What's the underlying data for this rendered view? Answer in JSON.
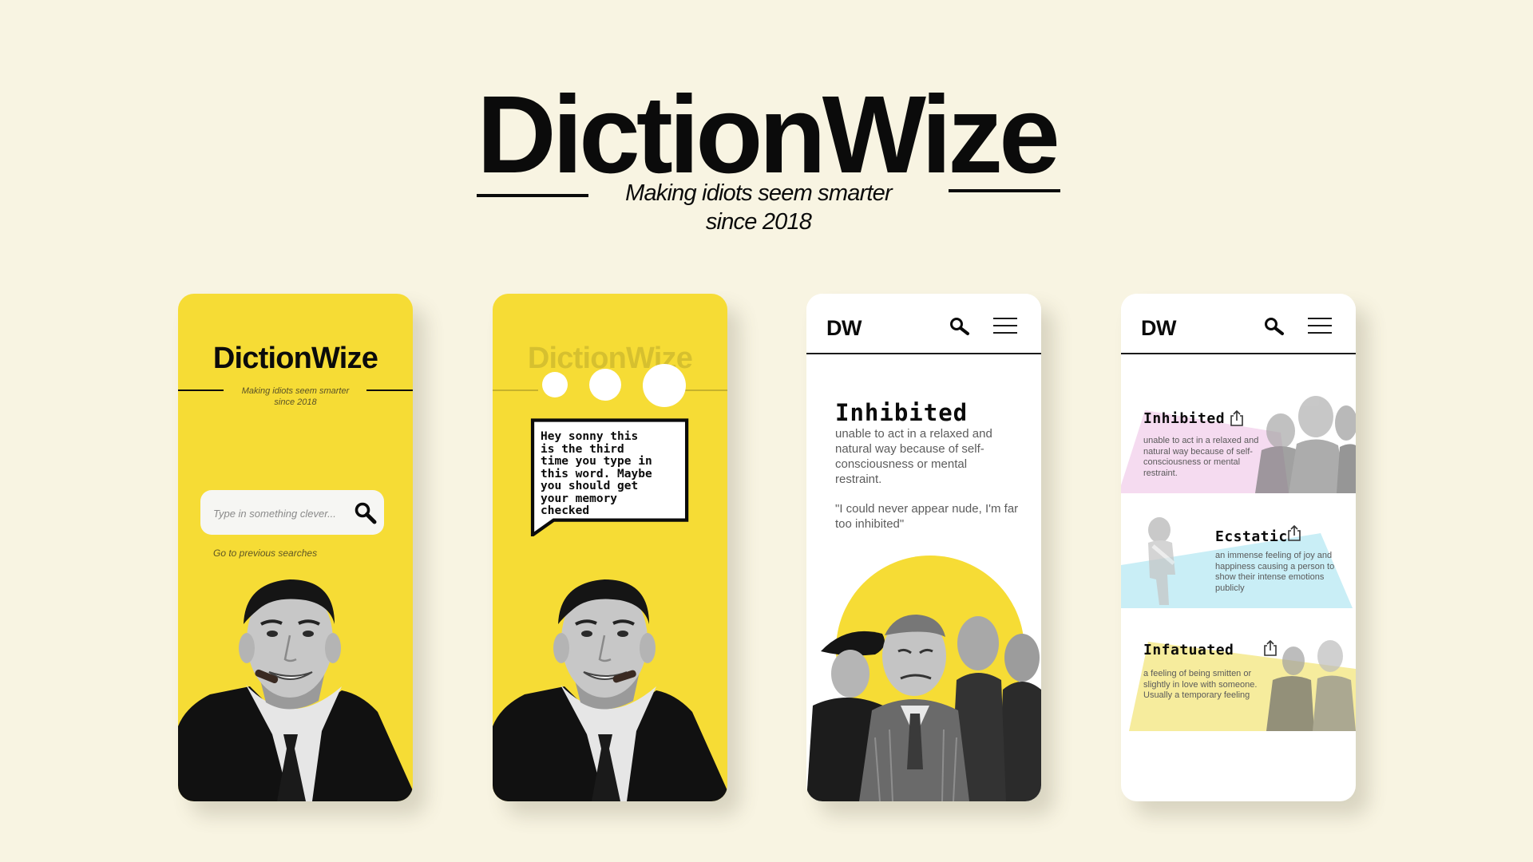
{
  "hero": {
    "title": "DictionWize",
    "tagline_line1": "Making idiots seem smarter",
    "tagline_line2": "since 2018"
  },
  "colors": {
    "background": "#f8f4e2",
    "brand_yellow": "#f6dc35",
    "ink": "#0b0b0b",
    "entry_pink": "#f5dbf0",
    "entry_cyan": "#c9eef6",
    "entry_yellow": "#f6ec9d"
  },
  "screen_home": {
    "logo": "DictionWize",
    "tagline_line1": "Making idiots seem smarter",
    "tagline_line2": "since 2018",
    "search_placeholder": "Type in something clever...",
    "search_icon": "search-icon",
    "previous_searches_link": "Go to previous searches"
  },
  "screen_chat": {
    "logo": "DictionWize",
    "bubble_text": "Hey sonny this\nis the third\ntime you type in\nthis word. Maybe\nyou should get\nyour memory\nchecked"
  },
  "screen_definition": {
    "nav_logo": "DW",
    "nav_search_icon": "search-icon",
    "nav_menu_icon": "hamburger-menu-icon",
    "word": "Inhibited",
    "definition": "unable to act in a relaxed and natural way because of self-consciousness or mental restraint.",
    "example": "\"I could never appear nude, I'm far too inhibited\""
  },
  "screen_list": {
    "nav_logo": "DW",
    "nav_search_icon": "search-icon",
    "nav_menu_icon": "hamburger-menu-icon",
    "entries": [
      {
        "word": "Inhibited",
        "definition": "unable to act in a relaxed and natural way because of self-consciousness or mental restraint.",
        "share_icon": "share-icon"
      },
      {
        "word": "Ecstatic",
        "definition": "an immense feeling of joy and happiness causing a person to show their intense emotions publicly",
        "share_icon": "share-icon"
      },
      {
        "word": "Infatuated",
        "definition": "a feeling of being smitten or slightly in love with someone. Usually a temporary feeling",
        "share_icon": "share-icon"
      }
    ]
  }
}
